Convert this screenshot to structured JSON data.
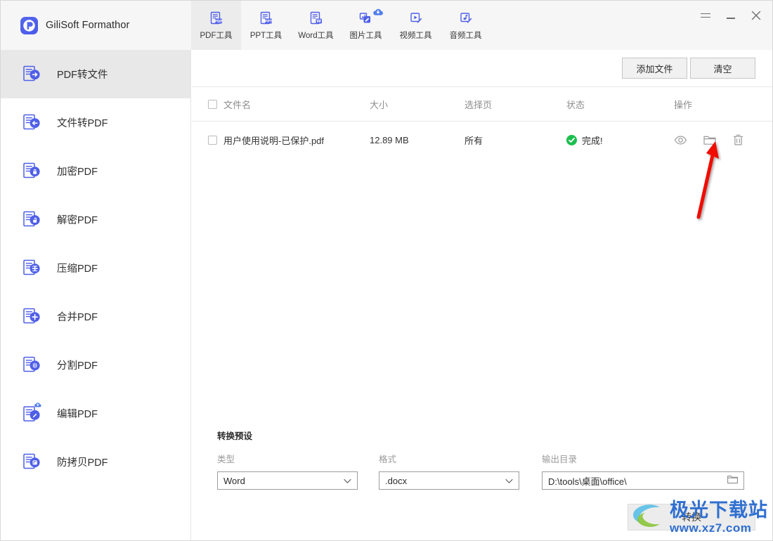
{
  "window": {
    "app_title": "GiliSoft Formathor",
    "logo_letter": "P",
    "controls": {
      "menu": "menu-hamburger",
      "minimize": "minimize",
      "close": "close"
    }
  },
  "tabs": [
    {
      "label": "PDF工具",
      "icon": "pdf-tool-icon",
      "active": true,
      "badge": false
    },
    {
      "label": "PPT工具",
      "icon": "ppt-tool-icon",
      "active": false,
      "badge": false
    },
    {
      "label": "Word工具",
      "icon": "word-tool-icon",
      "active": false,
      "badge": false
    },
    {
      "label": "图片工具",
      "icon": "image-tool-icon",
      "active": false,
      "badge": true
    },
    {
      "label": "视频工具",
      "icon": "video-tool-icon",
      "active": false,
      "badge": false
    },
    {
      "label": "音频工具",
      "icon": "audio-tool-icon",
      "active": false,
      "badge": false
    }
  ],
  "sidebar": {
    "items": [
      {
        "label": "PDF转文件",
        "icon": "pdf-to-file-icon",
        "active": true,
        "badge": false
      },
      {
        "label": "文件转PDF",
        "icon": "file-to-pdf-icon",
        "active": false,
        "badge": false
      },
      {
        "label": "加密PDF",
        "icon": "encrypt-pdf-icon",
        "active": false,
        "badge": false
      },
      {
        "label": "解密PDF",
        "icon": "decrypt-pdf-icon",
        "active": false,
        "badge": false
      },
      {
        "label": "压缩PDF",
        "icon": "compress-pdf-icon",
        "active": false,
        "badge": false
      },
      {
        "label": "合并PDF",
        "icon": "merge-pdf-icon",
        "active": false,
        "badge": false
      },
      {
        "label": "分割PDF",
        "icon": "split-pdf-icon",
        "active": false,
        "badge": false
      },
      {
        "label": "编辑PDF",
        "icon": "edit-pdf-icon",
        "active": false,
        "badge": true
      },
      {
        "label": "防拷贝PDF",
        "icon": "anticopy-pdf-icon",
        "active": false,
        "badge": false
      }
    ]
  },
  "toolbar": {
    "add_files_label": "添加文件",
    "clear_label": "清空"
  },
  "file_table": {
    "columns": {
      "filename": "文件名",
      "size": "大小",
      "pages": "选择页",
      "status": "状态",
      "actions": "操作"
    },
    "rows": [
      {
        "checked": false,
        "filename": "用户使用说明-已保护.pdf",
        "size": "12.89 MB",
        "pages": "所有",
        "status": "完成!",
        "status_color": "#1bbf4d",
        "actions": [
          "preview-eye-icon",
          "open-folder-icon",
          "delete-trash-icon"
        ]
      }
    ]
  },
  "preset": {
    "title": "转换预设",
    "type_label": "类型",
    "type_value": "Word",
    "format_label": "格式",
    "format_value": ".docx",
    "output_label": "输出目录",
    "output_value": "D:\\tools\\桌面\\office\\"
  },
  "convert": {
    "label": "转换"
  },
  "watermark": {
    "main": "极光下载站",
    "sub": "www.xz7.com"
  },
  "annotation": {
    "arrow_color": "#f01000",
    "points_to": "open-folder-icon"
  },
  "colors": {
    "brand_blue": "#4f5fe8",
    "accent_green": "#1bbf4d",
    "topbar_bg": "#f6f6f6",
    "tab_active_bg": "#ececec",
    "sidebar_active_bg": "#e8e8e8"
  }
}
